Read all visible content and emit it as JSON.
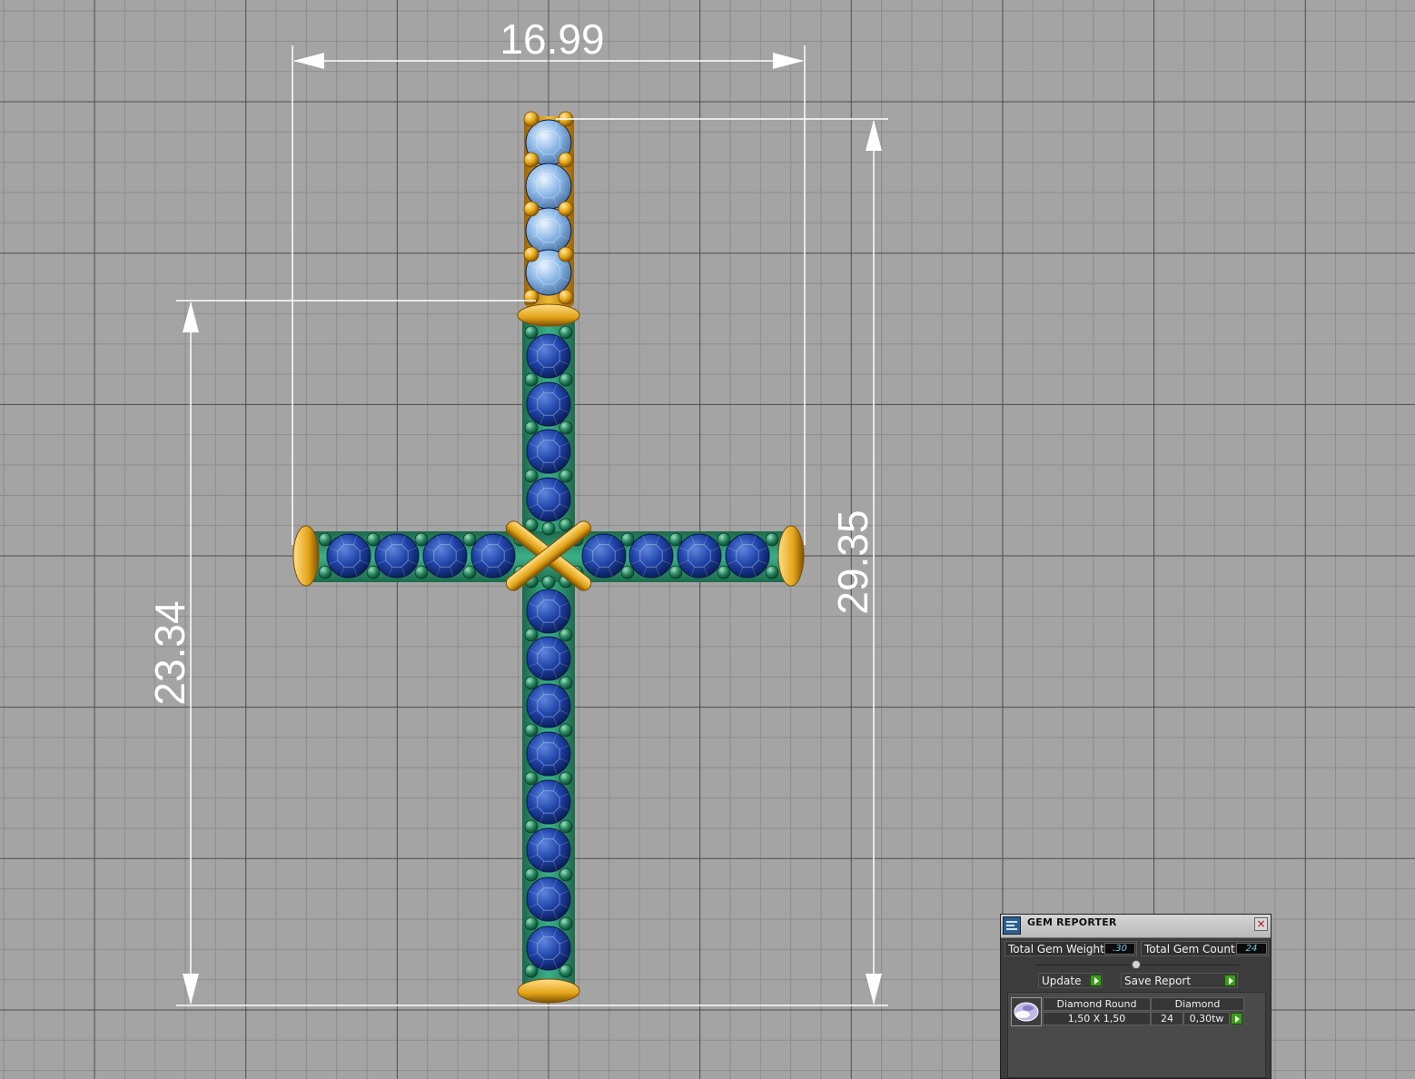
{
  "dimensions": {
    "width": "16.99",
    "height_total": "29.35",
    "height_lower": "23.34"
  },
  "colors": {
    "background": "#a4a4a4",
    "grid_minor": "#8c8c8c",
    "grid_major": "#4a4a4a",
    "metal_gold": "#e8aa1c",
    "metal_green": "#2f9a72",
    "stone_blue": "#1d3fa6",
    "stone_light": "#9ac3ee",
    "dimension_lines": "#ffffff"
  },
  "gem_reporter": {
    "title": "GEM REPORTER",
    "total_weight_label": "Total Gem Weight",
    "total_weight_value": ".30",
    "total_count_label": "Total Gem Count",
    "total_count_value": "24",
    "update_label": "Update",
    "save_report_label": "Save Report",
    "rows": [
      {
        "cut": "Diamond Round",
        "material": "Diamond",
        "size": "1,50 X 1,50",
        "count": "24",
        "weight": "0,30tw"
      }
    ]
  }
}
